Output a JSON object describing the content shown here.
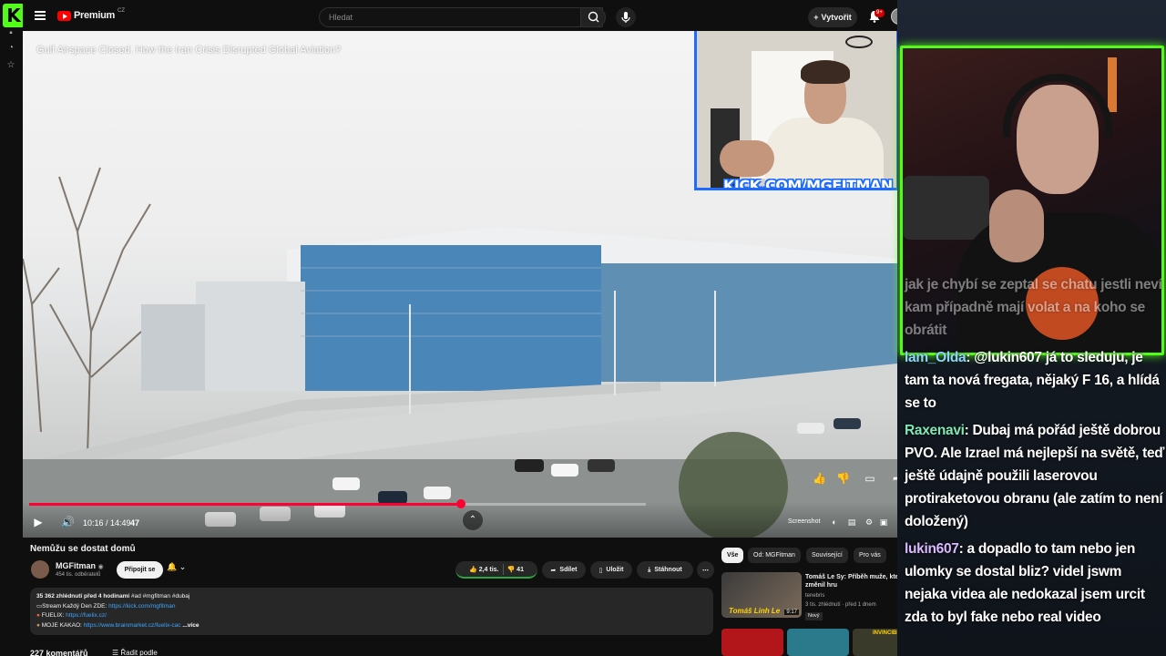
{
  "app": {
    "kick_logo": "K",
    "yt_brand": "Premium",
    "yt_brand_suffix": "CZ"
  },
  "topbar": {
    "search_placeholder": "Hledat",
    "create_label": "Vytvořit",
    "notifications_badge": "9+"
  },
  "video": {
    "overlay_title": "Gulf Airspace Closed. How the Iran Crisis Disrupted Global Aviation?",
    "kick_url": "KICK.COM/MGFITMAN",
    "time_label": "10:16 / 14:49",
    "progress_fraction": 0.7,
    "buffer_fraction": 0.72,
    "screenshot_label": "Screenshot",
    "overlay_marker": "47"
  },
  "below": {
    "title": "Nemůžu se dostat domů",
    "channel_name": "MGFitman",
    "channel_subs": "454 tis. odběratelů",
    "join_label": "Připojit se",
    "likes": "2,4 tis.",
    "dislikes": "41",
    "share_label": "Sdílet",
    "save_label": "Uložit",
    "download_label": "Stáhnout",
    "desc_line1_stats": "35 362 zhlédnutí  před 4 hodinami",
    "desc_line1_tags": "#ad #mgfitman #dubaj",
    "desc_line2_text": "Stream Každý Den ZDE: ",
    "desc_line2_link": "https://kick.com/mgfitman",
    "desc_line3_text": "FUELIX: ",
    "desc_line3_link": "https://fuelix.cz/",
    "desc_line4_text": "MOJE KAKAO: ",
    "desc_line4_link": "https://www.brainmarket.cz/fuelix-cac",
    "desc_more": "...více",
    "comments_count": "227 komentářů",
    "sort_label": "Řadit podle"
  },
  "recs": {
    "chips": [
      "Vše",
      "Od: MGFitman",
      "Související",
      "Pro vás"
    ],
    "item": {
      "title": "Tomáš Le Sy: Příběh muže, který změnil hru",
      "channel": "tenebris",
      "meta": "3 tis. zhlédnutí · před 1 dnem",
      "badge": "Nový",
      "thumb_text": "Tomáš Linh Le",
      "duration": "9:17"
    },
    "second_row_label": "INVINCIBLE"
  },
  "chat": {
    "messages": [
      {
        "user": "",
        "text": "jak je chybí se zeptal se chatu jestli neví kam případně mají volat a na koho se obrátit",
        "faded": true,
        "color": "#ffffff"
      },
      {
        "user": "lam_Olda",
        "text": ": @lukin607 já to sleduju, je tam ta nová fregata, nějaký F 16, a hlídá se to",
        "faded": false,
        "color": "#8fd3ff"
      },
      {
        "user": "Raxenavi",
        "text": ": Dubaj má pořád ještě dobrou PVO. Ale Izrael má nejlepší na světě, teď ještě údajně použili laserovou protiraketovou obranu (ale zatím to není doložený)",
        "faded": false,
        "color": "#7de8b4"
      },
      {
        "user": "lukin607",
        "text": ": a dopadlo to tam nebo jen ulomky se dostal bliz? videl jswm nejaka videa ale nedokazal jsem urcit zda to byl fake nebo real video",
        "faded": false,
        "color": "#d9b8ff"
      }
    ]
  }
}
